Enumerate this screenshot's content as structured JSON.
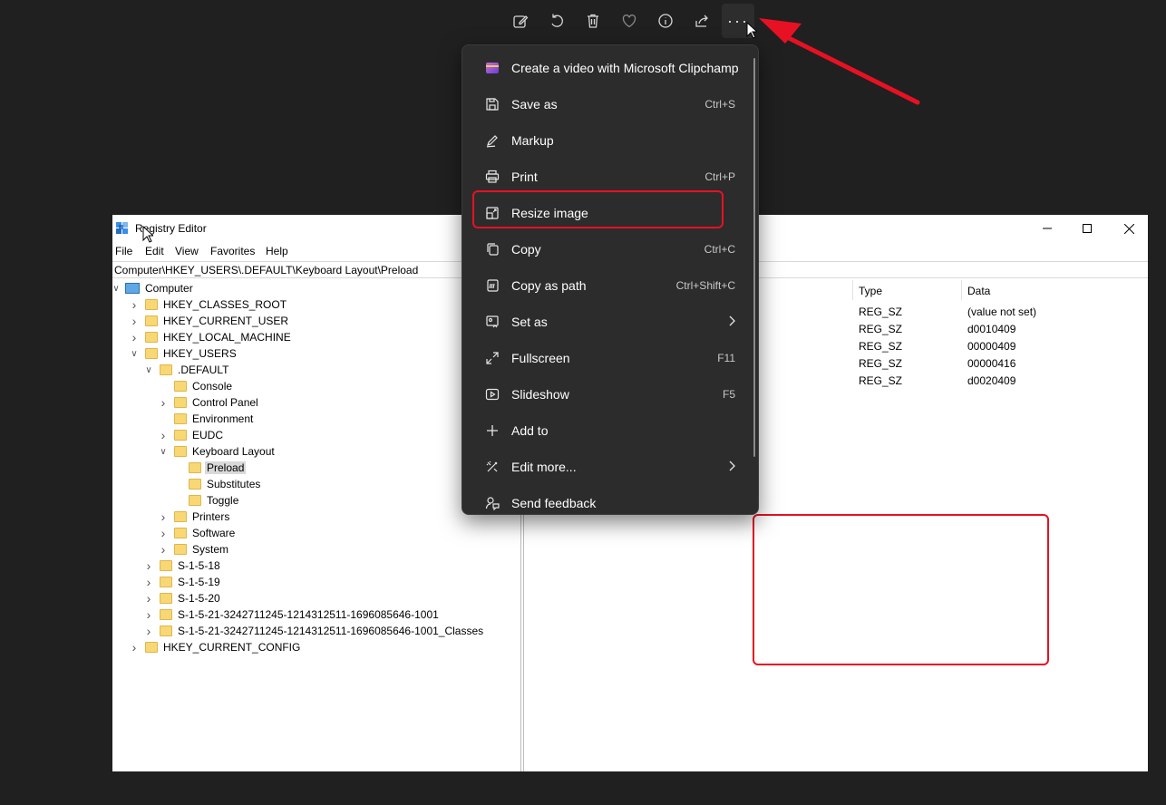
{
  "toolbar": {
    "items": [
      "edit-image-icon",
      "rotate-icon",
      "delete-icon",
      "favorite-icon",
      "info-icon",
      "share-icon",
      "more-icon"
    ],
    "more_label": "···"
  },
  "context_menu": {
    "items": [
      {
        "label": "Create a video with Microsoft Clipchamp",
        "shortcut": "",
        "icon": "clipchamp-icon"
      },
      {
        "label": "Save as",
        "shortcut": "Ctrl+S",
        "icon": "save-icon"
      },
      {
        "label": "Markup",
        "shortcut": "",
        "icon": "markup-pen-icon"
      },
      {
        "label": "Print",
        "shortcut": "Ctrl+P",
        "icon": "printer-icon"
      },
      {
        "label": "Resize image",
        "shortcut": "",
        "icon": "resize-icon"
      },
      {
        "label": "Copy",
        "shortcut": "Ctrl+C",
        "icon": "copy-icon"
      },
      {
        "label": "Copy as path",
        "shortcut": "Ctrl+Shift+C",
        "icon": "copy-path-icon"
      },
      {
        "label": "Set as",
        "shortcut": "",
        "icon": "set-as-icon",
        "submenu": true
      },
      {
        "label": "Fullscreen",
        "shortcut": "F11",
        "icon": "fullscreen-icon"
      },
      {
        "label": "Slideshow",
        "shortcut": "F5",
        "icon": "slideshow-icon"
      },
      {
        "label": "Add to",
        "shortcut": "",
        "icon": "plus-icon"
      },
      {
        "label": "Edit more...",
        "shortcut": "",
        "icon": "edit-more-icon",
        "submenu": true
      },
      {
        "label": "Send feedback",
        "shortcut": "",
        "icon": "feedback-icon"
      }
    ],
    "highlighted": "Resize image"
  },
  "regedit": {
    "title": "Registry Editor",
    "menu": [
      "File",
      "Edit",
      "View",
      "Favorites",
      "Help"
    ],
    "address": "Computer\\HKEY_USERS\\.DEFAULT\\Keyboard Layout\\Preload",
    "tree": [
      {
        "label": "Computer",
        "level": 0,
        "expanded": true
      },
      {
        "label": "HKEY_CLASSES_ROOT",
        "level": 1,
        "expandable": true
      },
      {
        "label": "HKEY_CURRENT_USER",
        "level": 1,
        "expandable": true
      },
      {
        "label": "HKEY_LOCAL_MACHINE",
        "level": 1,
        "expandable": true
      },
      {
        "label": "HKEY_USERS",
        "level": 1,
        "expanded": true
      },
      {
        "label": ".DEFAULT",
        "level": 2,
        "expanded": true
      },
      {
        "label": "Console",
        "level": 3
      },
      {
        "label": "Control Panel",
        "level": 3,
        "expandable": true
      },
      {
        "label": "Environment",
        "level": 3
      },
      {
        "label": "EUDC",
        "level": 3,
        "expandable": true
      },
      {
        "label": "Keyboard Layout",
        "level": 3,
        "expanded": true
      },
      {
        "label": "Preload",
        "level": 4,
        "selected": true
      },
      {
        "label": "Substitutes",
        "level": 4
      },
      {
        "label": "Toggle",
        "level": 4
      },
      {
        "label": "Printers",
        "level": 3,
        "expandable": true
      },
      {
        "label": "Software",
        "level": 3,
        "expandable": true
      },
      {
        "label": "System",
        "level": 3,
        "expandable": true
      },
      {
        "label": "S-1-5-18",
        "level": 2,
        "expandable": true
      },
      {
        "label": "S-1-5-19",
        "level": 2,
        "expandable": true
      },
      {
        "label": "S-1-5-20",
        "level": 2,
        "expandable": true
      },
      {
        "label": "S-1-5-21-3242711245-1214312511-1696085646-1001",
        "level": 2,
        "expandable": true
      },
      {
        "label": "S-1-5-21-3242711245-1214312511-1696085646-1001_Classes",
        "level": 2,
        "expandable": true
      },
      {
        "label": "HKEY_CURRENT_CONFIG",
        "level": 1,
        "expandable": true
      }
    ],
    "columns": {
      "type": "Type",
      "data": "Data"
    },
    "values": [
      {
        "type": "REG_SZ",
        "data": "(value not set)"
      },
      {
        "type": "REG_SZ",
        "data": "d0010409"
      },
      {
        "type": "REG_SZ",
        "data": "00000409"
      },
      {
        "type": "REG_SZ",
        "data": "00000416"
      },
      {
        "type": "REG_SZ",
        "data": "d0020409"
      }
    ]
  },
  "colors": {
    "background": "#202020",
    "menu_bg": "#2c2c2c",
    "annotation_red": "#e81123",
    "folder": "#f8d775"
  }
}
